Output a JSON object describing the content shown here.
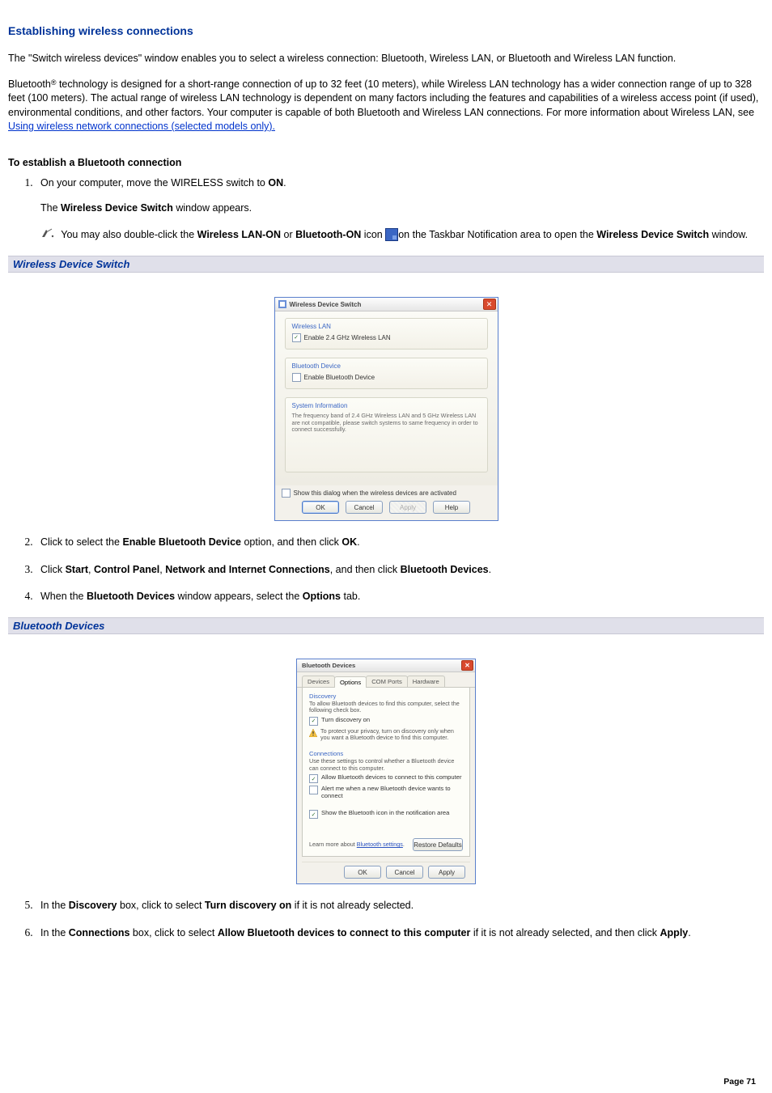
{
  "page": {
    "title": "Establishing wireless connections",
    "intro1": "The \"Switch wireless devices\" window enables you to select a wireless connection: Bluetooth, Wireless LAN, or Bluetooth and Wireless LAN function.",
    "intro2_pre": "Bluetooth",
    "intro2_reg": "®",
    "intro2_post": " technology is designed for a short-range connection of up to 32 feet (10 meters), while Wireless LAN technology has a wider connection range of up to 328 feet (100 meters). The actual range of wireless LAN technology is dependent on many factors including the features and capabilities of a wireless access point (if used), environmental conditions, and other factors. Your computer is capable of both Bluetooth and Wireless LAN connections. For more information about Wireless LAN, see ",
    "intro2_link": "Using wireless network connections (selected models only).",
    "bt_heading": "To establish a Bluetooth connection",
    "page_number": "Page 71"
  },
  "steps": {
    "s1_a": "On your computer, move the WIRELESS switch to ",
    "s1_b": "ON",
    "s1_c": ".",
    "s1_sub1_a": "The ",
    "s1_sub1_b": "Wireless Device Switch",
    "s1_sub1_c": " window appears.",
    "s1_note_a": "You may also double-click the ",
    "s1_note_b": "Wireless LAN-ON",
    "s1_note_c": " or ",
    "s1_note_d": "Bluetooth-ON",
    "s1_note_e": " icon ",
    "s1_note_f": "on the Taskbar Notification area to open the ",
    "s1_note_g": "Wireless Device Switch",
    "s1_note_h": " window.",
    "s2_a": "Click to select the ",
    "s2_b": "Enable Bluetooth Device",
    "s2_c": " option, and then click ",
    "s2_d": "OK",
    "s2_e": ".",
    "s3_a": "Click ",
    "s3_b": "Start",
    "s3_c": ", ",
    "s3_d": "Control Panel",
    "s3_e": ", ",
    "s3_f": "Network and Internet Connections",
    "s3_g": ", and then click ",
    "s3_h": "Bluetooth Devices",
    "s3_i": ".",
    "s4_a": "When the ",
    "s4_b": "Bluetooth Devices",
    "s4_c": " window appears, select the ",
    "s4_d": "Options",
    "s4_e": " tab.",
    "s5_a": "In the ",
    "s5_b": "Discovery",
    "s5_c": " box, click to select ",
    "s5_d": "Turn discovery on",
    "s5_e": " if it is not already selected.",
    "s6_a": "In the ",
    "s6_b": "Connections",
    "s6_c": " box, click to select ",
    "s6_d": "Allow Bluetooth devices to connect to this computer",
    "s6_e": " if it is not already selected, and then click ",
    "s6_f": "Apply",
    "s6_g": "."
  },
  "captions": {
    "wds": "Wireless Device Switch",
    "btd": "Bluetooth Devices"
  },
  "dialog1": {
    "title": "Wireless Device Switch",
    "group1": "Wireless LAN",
    "chk1": "Enable 2.4 GHz Wireless LAN",
    "group2": "Bluetooth Device",
    "chk2": "Enable Bluetooth Device",
    "group3": "System Information",
    "sysinfo": "The frequency band of 2.4 GHz Wireless LAN and 5 GHz Wireless LAN are not compatible, please switch systems to same frequency in order to connect successfully.",
    "show_dialog": "Show this dialog when the wireless devices are activated",
    "ok": "OK",
    "cancel": "Cancel",
    "apply": "Apply",
    "help": "Help"
  },
  "dialog2": {
    "title": "Bluetooth Devices",
    "tabs": [
      "Devices",
      "Options",
      "COM Ports",
      "Hardware"
    ],
    "discovery": "Discovery",
    "disc_text": "To allow Bluetooth devices to find this computer, select the following check box.",
    "disc_chk": "Turn discovery on",
    "disc_warn": "To protect your privacy, turn on discovery only when you want a Bluetooth device to find this computer.",
    "connections": "Connections",
    "conn_text": "Use these settings to control whether a Bluetooth device can connect to this computer.",
    "conn_chk1": "Allow Bluetooth devices to connect to this computer",
    "conn_chk2": "Alert me when a new Bluetooth device wants to connect",
    "show_icon": "Show the Bluetooth icon in the notification area",
    "learn_pre": "Learn more about ",
    "learn_link": "Bluetooth settings",
    "restore": "Restore Defaults",
    "ok": "OK",
    "cancel": "Cancel",
    "apply": "Apply"
  }
}
